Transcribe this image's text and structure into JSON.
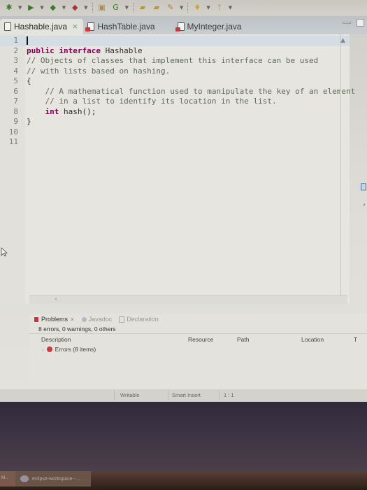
{
  "toolbar": {
    "icons": [
      "debug-icon",
      "run-icon",
      "run-config-icon",
      "external-tools-icon",
      "new-java-package-icon",
      "new-class-icon",
      "open-type-icon",
      "open-task-icon",
      "search-icon",
      "annotation-icon",
      "navigate-icon",
      "back-icon",
      "forward-icon"
    ]
  },
  "editor_tabs": [
    {
      "label": "Hashable.java",
      "active": true,
      "has_error": false,
      "close": "⨯"
    },
    {
      "label": "HashTable.java",
      "active": false,
      "has_error": true
    },
    {
      "label": "MyInteger.java",
      "active": false,
      "has_error": true
    }
  ],
  "editor": {
    "lines": [
      {
        "n": "1",
        "text": ""
      },
      {
        "n": "2",
        "text": "public interface Hashable"
      },
      {
        "n": "3",
        "text": "// Objects of classes that implement this interface can be used"
      },
      {
        "n": "4",
        "text": "// with lists based on hashing."
      },
      {
        "n": "5",
        "text": "{"
      },
      {
        "n": "6",
        "text": "    // A mathematical function used to manipulate the key of an element"
      },
      {
        "n": "7",
        "text": "    // in a list to identify its location in the list."
      },
      {
        "n": "8",
        "text": "    int hash();"
      },
      {
        "n": "9",
        "text": "}"
      },
      {
        "n": "10",
        "text": ""
      },
      {
        "n": "11",
        "text": ""
      }
    ]
  },
  "problems_panel": {
    "tabs": [
      {
        "label": "Problems",
        "active": true
      },
      {
        "label": "Javadoc",
        "active": false
      },
      {
        "label": "Declaration",
        "active": false
      }
    ],
    "summary": "8 errors, 0 warnings, 0 others",
    "columns": [
      "Description",
      "Resource",
      "Path",
      "Location",
      "T"
    ],
    "rows": [
      {
        "label": "Errors (8 items)",
        "expanded": false
      }
    ]
  },
  "statusbar": {
    "writable": "Writable",
    "insert_mode": "Smart Insert",
    "position": "1 : 1"
  },
  "taskbar": {
    "left_label": "M...",
    "app_label": "eclipse-workspace - ..."
  },
  "colors": {
    "keyword": "#7f0055",
    "comment": "#5f6a5a",
    "error": "#c9393d"
  }
}
